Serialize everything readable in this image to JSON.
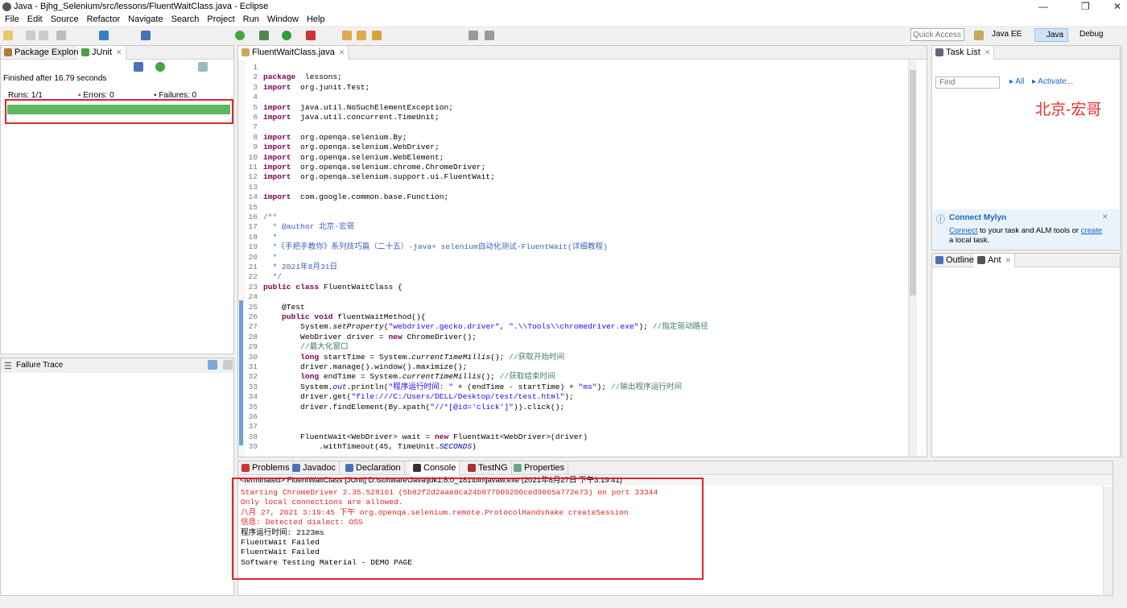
{
  "window": {
    "title": "Java - Bjhg_Selenium/src/lessons/FluentWaitClass.java - Eclipse"
  },
  "menu": [
    "File",
    "Edit",
    "Source",
    "Refactor",
    "Navigate",
    "Search",
    "Project",
    "Run",
    "Window",
    "Help"
  ],
  "toolbar": {
    "quick_access_placeholder": "Quick Access",
    "perspectives": [
      "Java EE",
      "Java",
      "Debug"
    ]
  },
  "left": {
    "tabs": [
      "Package Explorer",
      "JUnit"
    ],
    "status": "Finished after 16.79 seconds",
    "runs_label": "Runs:",
    "runs": "1/1",
    "errors_label": "Errors:",
    "errors": "0",
    "failures_label": "Failures:",
    "failures": "0",
    "progress": 1.0,
    "progress_color": "#5cb85c",
    "failure_trace": "Failure Trace"
  },
  "editor": {
    "tab": "FluentWaitClass.java",
    "lines": [
      [],
      [
        [
          "kw",
          "package"
        ],
        [
          "",
          "  lessons;"
        ]
      ],
      [
        [
          "kw",
          "import"
        ],
        [
          "",
          "  org.junit.Test;"
        ]
      ],
      [],
      [
        [
          "kw",
          "import"
        ],
        [
          "",
          "  java.util.NoSuchElementException;"
        ]
      ],
      [
        [
          "kw",
          "import"
        ],
        [
          "",
          "  java.util.concurrent.TimeUnit;"
        ]
      ],
      [],
      [
        [
          "kw",
          "import"
        ],
        [
          "",
          "  org.openqa.selenium.By;"
        ]
      ],
      [
        [
          "kw",
          "import"
        ],
        [
          "",
          "  org.openqa.selenium.WebDriver;"
        ]
      ],
      [
        [
          "kw",
          "import"
        ],
        [
          "",
          "  org.openqa.selenium.WebElement;"
        ]
      ],
      [
        [
          "kw",
          "import"
        ],
        [
          "",
          "  org.openqa.selenium.chrome.ChromeDriver;"
        ]
      ],
      [
        [
          "kw",
          "import"
        ],
        [
          "",
          "  org.openqa.selenium.support.ui.FluentWait;"
        ]
      ],
      [],
      [
        [
          "kw",
          "import"
        ],
        [
          "",
          "  com.google.common.base.Function;"
        ]
      ],
      [],
      [
        [
          "jd",
          "/**"
        ]
      ],
      [
        [
          "jd",
          "  * @author 北京-宏哥"
        ]
      ],
      [
        [
          "jd",
          "  *"
        ]
      ],
      [
        [
          "jd",
          "  *《手把手教你》系列技巧篇（二十五）-java+ selenium自动化测试-FluentWait(详细教程)"
        ]
      ],
      [
        [
          "jd",
          "  *"
        ]
      ],
      [
        [
          "jd",
          "  * 2021年8月31日"
        ]
      ],
      [
        [
          "jd",
          "  */"
        ]
      ],
      [
        [
          "kw",
          "public class"
        ],
        [
          "",
          " FluentWaitClass {"
        ]
      ],
      [],
      [
        [
          "",
          "    @Test"
        ]
      ],
      [
        [
          "",
          "    "
        ],
        [
          "kw",
          "public void"
        ],
        [
          "",
          " fluentWaitMethod(){"
        ]
      ],
      [
        [
          "",
          "        System."
        ],
        [
          "it",
          "setProperty"
        ],
        [
          "",
          "("
        ],
        [
          "str",
          "\"webdriver.gecko.driver\""
        ],
        [
          "",
          ", "
        ],
        [
          "str",
          "\".\\\\Tools\\\\chromedriver.exe\""
        ],
        [
          "",
          "); "
        ],
        [
          "cm",
          "//指定驱动路径"
        ]
      ],
      [
        [
          "",
          "        WebDriver driver = "
        ],
        [
          "kw",
          "new"
        ],
        [
          "",
          " ChromeDriver();"
        ]
      ],
      [
        [
          "cm",
          "        //最大化窗口"
        ]
      ],
      [
        [
          "",
          "        "
        ],
        [
          "kw",
          "long"
        ],
        [
          "",
          " startTime = System."
        ],
        [
          "it",
          "currentTimeMillis"
        ],
        [
          "",
          "(); "
        ],
        [
          "cm",
          "//获取开始时间"
        ]
      ],
      [
        [
          "",
          "        driver.manage().window().maximize();"
        ]
      ],
      [
        [
          "",
          "        "
        ],
        [
          "kw",
          "long"
        ],
        [
          "",
          " endTime = System."
        ],
        [
          "it",
          "currentTimeMillis"
        ],
        [
          "",
          "(); "
        ],
        [
          "cm",
          "//获取结束时间"
        ]
      ],
      [
        [
          "",
          "        System."
        ],
        [
          "fld it",
          "out"
        ],
        [
          "",
          ".println("
        ],
        [
          "str",
          "\"程序运行时间: \""
        ],
        [
          "",
          " + (endTime - startTime) + "
        ],
        [
          "str",
          "\"ms\""
        ],
        [
          "",
          "); "
        ],
        [
          "cm",
          "//输出程序运行时间"
        ]
      ],
      [
        [
          "",
          "        driver.get("
        ],
        [
          "str",
          "\"file:///C:/Users/DELL/Desktop/test/test.html\""
        ],
        [
          "",
          ");"
        ]
      ],
      [
        [
          "",
          "        driver.findElement(By.xpath("
        ],
        [
          "str",
          "\"//*[@id='click']\""
        ],
        [
          "",
          ")).click();"
        ]
      ],
      [],
      [],
      [
        [
          "",
          "        FluentWait<WebDriver> wait = "
        ],
        [
          "kw",
          "new"
        ],
        [
          "",
          " FluentWait<WebDriver>(driver)"
        ]
      ],
      [
        [
          "",
          "            .withTimeout(45, TimeUnit."
        ],
        [
          "fld it",
          "SECONDS"
        ],
        [
          "",
          ")"
        ]
      ]
    ]
  },
  "right": {
    "task_list": "Task List",
    "find_placeholder": "Find",
    "all": "All",
    "activate": "Activate...",
    "watermark": "北京-宏哥",
    "mylyn": {
      "title": "Connect Mylyn",
      "connect": "Connect",
      "text1": " to your task and ALM tools or ",
      "create": "create",
      "text2": "a local task."
    },
    "outline_tabs": [
      "Outline",
      "Ant"
    ]
  },
  "bottom": {
    "tabs": [
      "Problems",
      "Javadoc",
      "Declaration",
      "Console",
      "TestNG",
      "Properties"
    ],
    "terminated": "<terminated> FluentWaitClass [JUnit] D:\\software\\Java\\jdk1.8.0_181\\bin\\javaw.exe (2021年8月27日 下午3:19:41)",
    "console": [
      {
        "text": "Starting ChromeDriver 2.35.528161 (5b82f2d2aae0ca24b877009200ced9065a772e73) on port 33344",
        "err": true
      },
      {
        "text": "Only local connections are allowed.",
        "err": true
      },
      {
        "text": "八月 27, 2021 3:19:45 下午 org.openqa.selenium.remote.ProtocolHandshake createSession",
        "err": true
      },
      {
        "text": "信息: Detected dialect: OSS",
        "err": true
      },
      {
        "text": "程序运行时间: 2123ms",
        "err": false
      },
      {
        "text": "FluentWait Failed",
        "err": false
      },
      {
        "text": "FluentWait Failed",
        "err": false
      },
      {
        "text": "Software Testing Material - DEMO PAGE",
        "err": false
      }
    ]
  }
}
